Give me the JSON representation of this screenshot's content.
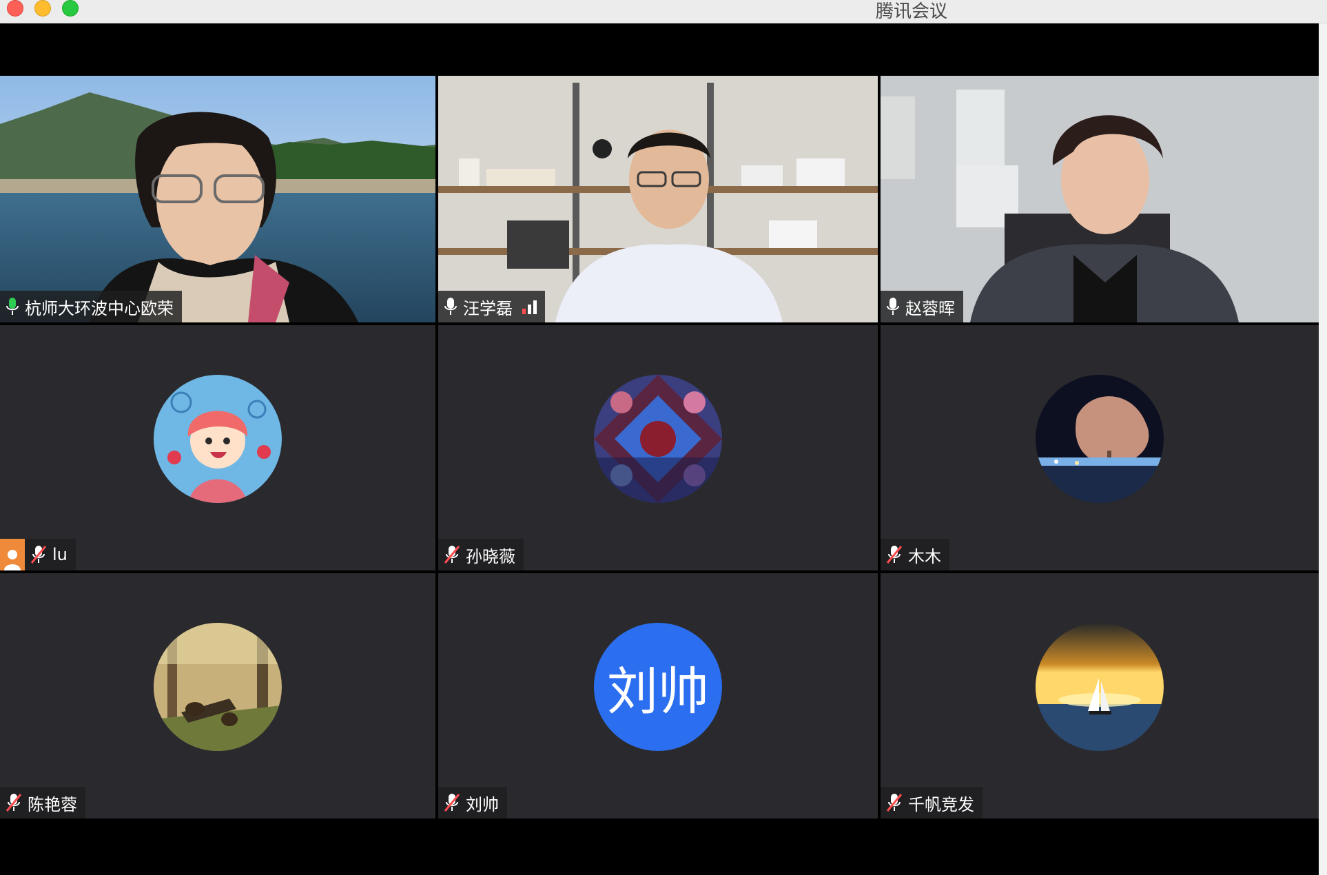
{
  "window": {
    "title": "腾讯会议"
  },
  "colors": {
    "active_speaker_border": "#36c24a",
    "tile_background": "#2a2a2e",
    "text_avatar_blue": "#2b6ff0",
    "stage_background": "#000000"
  },
  "participants": [
    {
      "name": "杭师大环波中心欧荣",
      "video": true,
      "mic": "on",
      "active_speaker": true
    },
    {
      "name": "汪学磊",
      "video": true,
      "mic": "on",
      "signal_bars": 3
    },
    {
      "name": "赵蓉晖",
      "video": true,
      "mic": "on"
    },
    {
      "name": "lu",
      "video": false,
      "mic": "muted",
      "avatar_icon": "cartoon-girl-avatar"
    },
    {
      "name": "孙晓薇",
      "video": false,
      "mic": "muted",
      "avatar_icon": "floral-pattern-avatar"
    },
    {
      "name": "木木",
      "video": false,
      "mic": "muted",
      "avatar_icon": "night-tree-avatar"
    },
    {
      "name": "陈艳蓉",
      "video": false,
      "mic": "muted",
      "avatar_icon": "bears-in-forest-avatar"
    },
    {
      "name": "刘帅",
      "video": false,
      "mic": "muted",
      "avatar_text": "刘帅"
    },
    {
      "name": "千帆竞发",
      "video": false,
      "mic": "muted",
      "avatar_icon": "sunset-sailboat-avatar"
    }
  ]
}
